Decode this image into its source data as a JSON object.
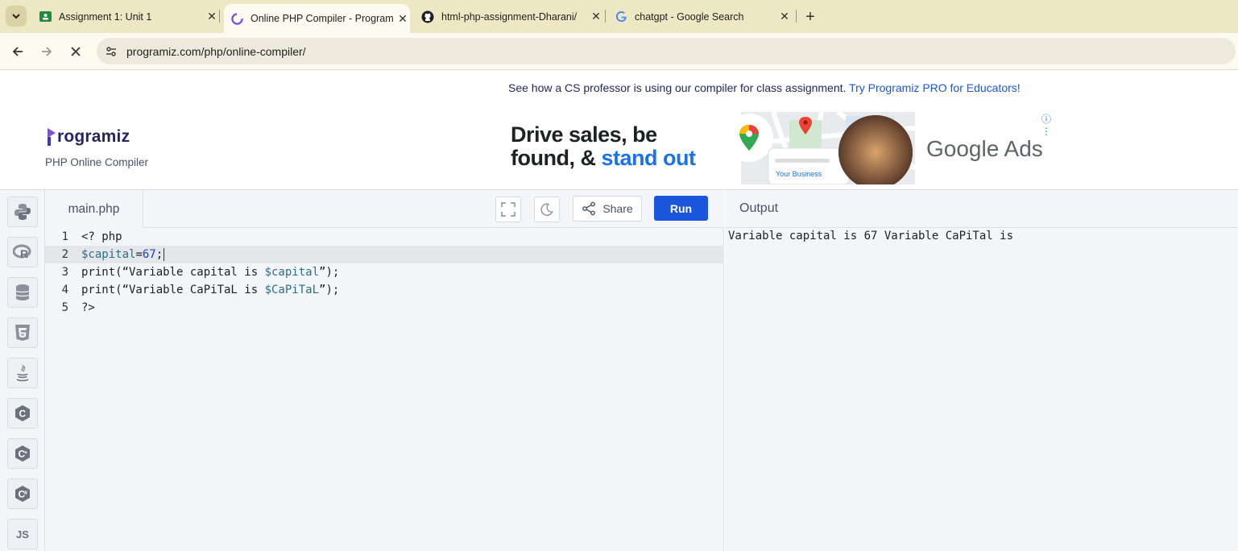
{
  "browser": {
    "tabs": [
      {
        "title": "Assignment 1: Unit 1",
        "icon": "classroom-icon",
        "active": false
      },
      {
        "title": "Online PHP Compiler - Program",
        "icon": "programiz-icon",
        "active": true
      },
      {
        "title": "html-php-assignment-Dharani/",
        "icon": "github-icon",
        "active": false
      },
      {
        "title": "chatgpt - Google Search",
        "icon": "google-icon",
        "active": false
      }
    ],
    "url": "programiz.com/php/online-compiler/"
  },
  "promo": {
    "text": "See how a CS professor is using our compiler for class assignment.",
    "link": "Try Programiz PRO for Educators!"
  },
  "logo": {
    "name": "rogramiz",
    "subtitle": "PHP Online Compiler"
  },
  "ad": {
    "headline_1": "Drive sales, be",
    "headline_2a": "found, & ",
    "headline_2b": "stand out",
    "card_label": "Your Business",
    "brand": "Google Ads"
  },
  "editor": {
    "filename": "main.php",
    "share_label": "Share",
    "run_label": "Run",
    "lines": [
      {
        "n": "1",
        "code": "<? php"
      },
      {
        "n": "2",
        "code": "$capital=67;"
      },
      {
        "n": "3",
        "code": "print(“Variable capital is $capital”);"
      },
      {
        "n": "4",
        "code": "print(“Variable CaPiTaL is $CaPiTaL”);"
      },
      {
        "n": "5",
        "code": "?>"
      }
    ]
  },
  "output": {
    "title": "Output",
    "text": "Variable capital is 67 Variable CaPiTal is"
  },
  "languages": [
    "python-icon",
    "r-icon",
    "sql-icon",
    "html5-icon",
    "java-icon",
    "c-icon",
    "cpp-icon",
    "csharp-icon",
    "js-icon"
  ],
  "js_label": "JS",
  "colors": {
    "run": "#1a56db",
    "accent_link": "#1a56db",
    "tabstrip": "#ede7c4"
  }
}
